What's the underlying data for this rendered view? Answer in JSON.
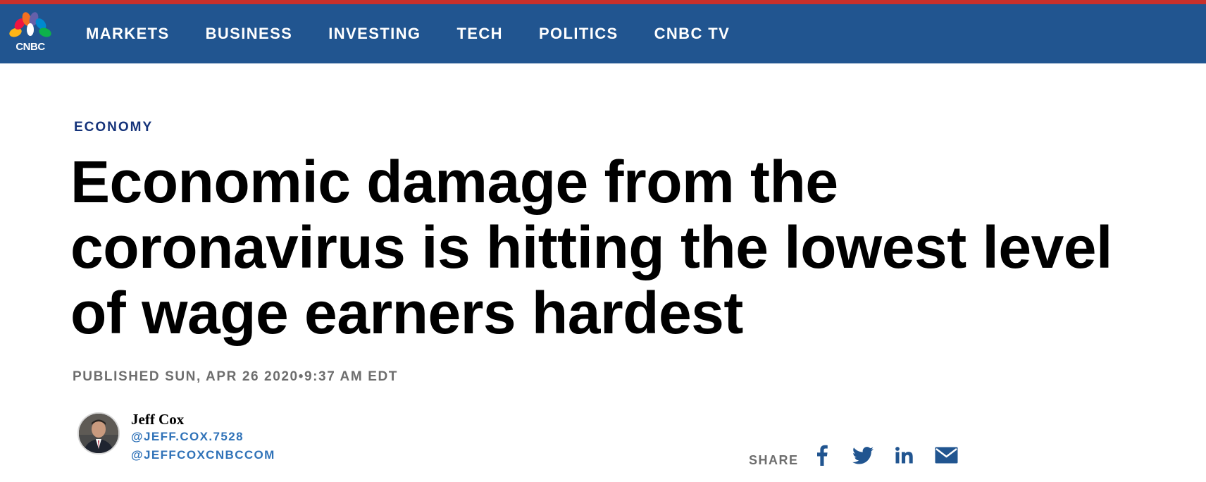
{
  "brand": {
    "logo_text": "CNBC",
    "accent_color": "#c8302b",
    "nav_color": "#215590"
  },
  "nav": {
    "items": [
      {
        "label": "MARKETS"
      },
      {
        "label": "BUSINESS"
      },
      {
        "label": "INVESTING"
      },
      {
        "label": "TECH"
      },
      {
        "label": "POLITICS"
      },
      {
        "label": "CNBC TV"
      }
    ]
  },
  "article": {
    "section": "ECONOMY",
    "headline_lines": [
      "Economic damage from the",
      "coronavirus is hitting the lowest level",
      "of wage earners hardest"
    ],
    "published": "PUBLISHED SUN, APR 26 2020•9:37 AM EDT"
  },
  "author": {
    "name": "Jeff Cox",
    "handles": [
      "@JEFF.COX.7528",
      "@JEFFCOXCNBCCOM"
    ],
    "avatar_icon": "author-photo"
  },
  "share": {
    "label": "SHARE",
    "icons": [
      "facebook-icon",
      "twitter-icon",
      "linkedin-icon",
      "email-icon"
    ],
    "icon_color": "#215590"
  }
}
